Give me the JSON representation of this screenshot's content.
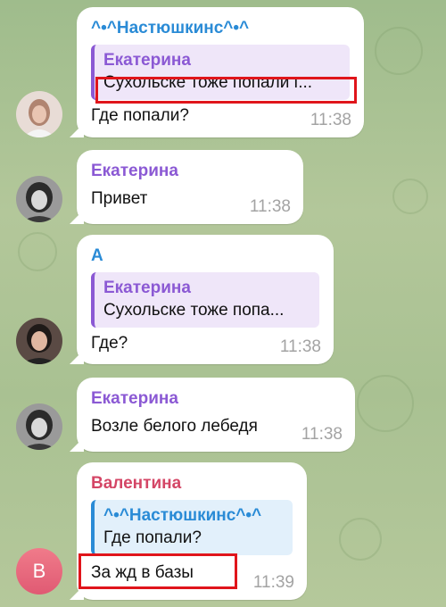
{
  "colors": {
    "blue_sender": "#2a8bd6",
    "purple_sender": "#8b59d4",
    "red_sender": "#d44666",
    "highlight": "#e0151b"
  },
  "messages": [
    {
      "sender": "^•^Настюшкинс^•^",
      "reply_name": "Екатерина",
      "reply_text": "Сухольске тоже попали г...",
      "text": "Где попали?",
      "time": "11:38"
    },
    {
      "sender": "Екатерина",
      "text": "Привет",
      "time": "11:38"
    },
    {
      "sender": "А",
      "reply_name": "Екатерина",
      "reply_text": "Сухольске тоже попа...",
      "text": "Где?",
      "time": "11:38"
    },
    {
      "sender": "Екатерина",
      "text": "Возле белого лебедя",
      "time": "11:38"
    },
    {
      "sender": "Валентина",
      "reply_name": "^•^Настюшкинс^•^",
      "reply_text": "Где попали?",
      "text": "За жд в базы",
      "time": "11:39",
      "avatar_letter": "В"
    }
  ]
}
